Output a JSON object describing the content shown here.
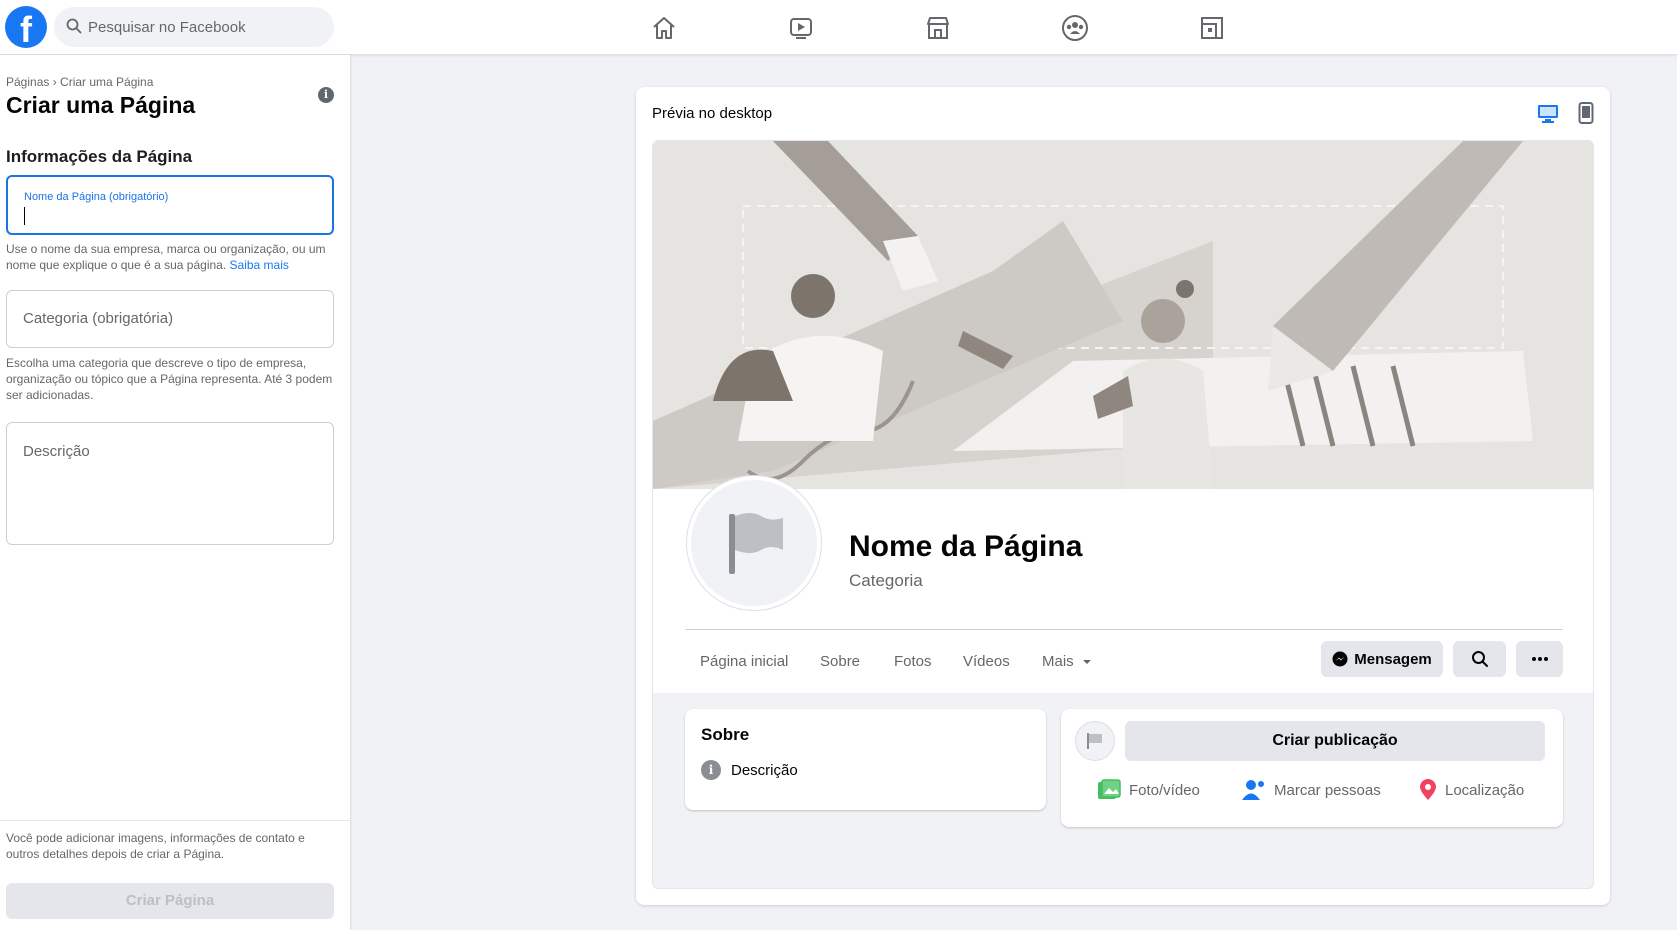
{
  "topbar": {
    "logo": "f",
    "search_placeholder": "Pesquisar no Facebook",
    "nav_icons": [
      "home-icon",
      "watch-icon",
      "marketplace-icon",
      "groups-icon",
      "gaming-icon"
    ]
  },
  "left": {
    "breadcrumb": "Páginas › Criar uma Página",
    "title": "Criar uma Página",
    "info_icon": "i",
    "section_title": "Informações da Página",
    "name_field": {
      "label": "Nome da Página (obrigatório)",
      "value": ""
    },
    "name_helper": "Use o nome da sua empresa, marca ou organização, ou um nome que explique o que é a sua página.",
    "name_helper_link": "Saiba mais",
    "category_placeholder": "Categoria (obrigatória)",
    "category_helper": "Escolha uma categoria que descreve o tipo de empresa, organização ou tópico que a Página representa. Até 3 podem ser adicionadas.",
    "description_placeholder": "Descrição",
    "bottom_note": "Você pode adicionar imagens, informações de contato e outros detalhes depois de criar a Página.",
    "create_button": "Criar Página"
  },
  "preview": {
    "title": "Prévia no desktop",
    "page_name": "Nome da Página",
    "category": "Categoria",
    "tabs": [
      "Página inicial",
      "Sobre",
      "Fotos",
      "Vídeos",
      "Mais"
    ],
    "message_button": "Mensagem",
    "about": {
      "title": "Sobre",
      "info_icon": "i",
      "description": "Descrição"
    },
    "post": {
      "create_button": "Criar publicação",
      "actions": [
        {
          "label": "Foto/vídeo",
          "icon": "photo-icon",
          "color": "#45bd62"
        },
        {
          "label": "Marcar pessoas",
          "icon": "tag-people-icon",
          "color": "#1877f2"
        },
        {
          "label": "Localização",
          "icon": "location-pin-icon",
          "color": "#f3425f"
        }
      ]
    }
  },
  "colors": {
    "brand": "#1877f2",
    "focus": "#1b74e4",
    "disabled_text": "#bcc0c4"
  }
}
